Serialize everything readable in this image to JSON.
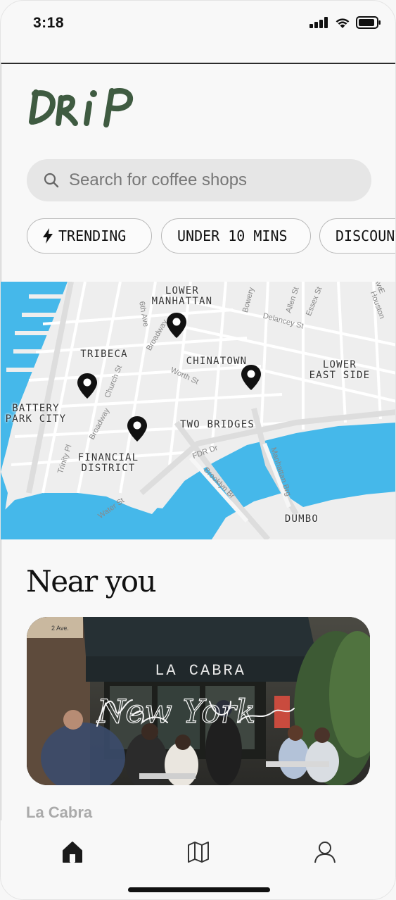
{
  "status_bar": {
    "time": "3:18"
  },
  "app": {
    "logo_text": "DRiP"
  },
  "search": {
    "placeholder": "Search for coffee shops"
  },
  "filters": [
    {
      "label": "TRENDING",
      "icon": "bolt-icon"
    },
    {
      "label": "UNDER 10 MINS"
    },
    {
      "label": "DISCOUNTS"
    }
  ],
  "map": {
    "neighborhoods": {
      "lower_manhattan": "LOWER\nMANHATTAN",
      "tribeca": "TRIBECA",
      "chinatown": "CHINATOWN",
      "lower_east_side": "LOWER\nEAST SIDE",
      "battery_park_city": "BATTERY\nPARK CITY",
      "two_bridges": "TWO BRIDGES",
      "financial_district": "FINANCIAL\nDISTRICT",
      "dumbo": "DUMBO"
    },
    "streets": [
      "6th Ave",
      "Broadway",
      "Bowery",
      "Allen St",
      "Essex St",
      "Delancey St",
      "Church St",
      "Worth St",
      "Broadway",
      "Trinity Pl",
      "FDR Dr",
      "Brooklyn Br",
      "Manhattan Brg",
      "Water St",
      "E Houston",
      "Ave"
    ],
    "colors": {
      "water": "#45b8ea",
      "land": "#eeeeee",
      "roads": "#ffffff"
    }
  },
  "near_you": {
    "heading": "Near you",
    "card": {
      "name": "La Cabra",
      "awning_text": "LA CABRA",
      "script_overlay": "New York",
      "street_sign": "2 Ave."
    }
  },
  "tabs": [
    {
      "name": "home-tab",
      "icon": "home-icon"
    },
    {
      "name": "map-tab",
      "icon": "map-icon"
    },
    {
      "name": "profile-tab",
      "icon": "user-icon"
    }
  ]
}
